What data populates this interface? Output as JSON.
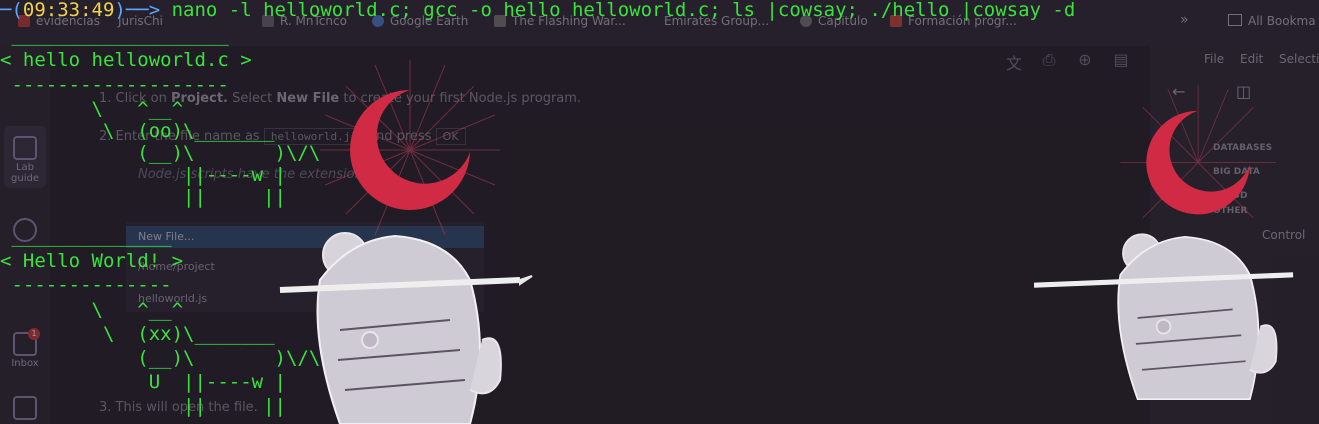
{
  "terminal": {
    "time": "09:33:49",
    "command": "nano -l helloworld.c; gcc -o hello helloworld.c; ls |cowsay; ./hello |cowsay -d",
    "cowsay_ls": {
      "bubble_top": " ___________________",
      "bubble_text": "< hello helloworld.c >",
      "bubble_bottom": " -------------------",
      "cow": "        \\   ^__^\n         \\  (oo)\\_______\n            (__)\\       )\\/\\\n                ||----w |\n                ||     ||"
    },
    "cowsay_hello": {
      "bubble_top": " ______________",
      "bubble_text": "< Hello World! >",
      "bubble_bottom": " --------------",
      "cow": "        \\   ^__^\n         \\  (xx)\\_______\n            (__)\\       )\\/\\\n             U  ||----w |\n                ||     ||"
    }
  },
  "background": {
    "tabs": [
      "evidencias",
      "JurisChi",
      "R. MnTcnco",
      "Google Earth",
      "The Flashing War...",
      "Emirates Group...",
      "Capitulo",
      "Formación progr..."
    ],
    "all_bookmarks": "All Bookma",
    "sidebar": {
      "lab_guide": "Lab guide",
      "inbox": "Inbox",
      "inbox_badge": "1"
    },
    "steps": {
      "step1_prefix": "1. Click on",
      "step1_bold1": "Project.",
      "step1_mid": "Select",
      "step1_bold2": "New File",
      "step1_suffix": "to create your first Node.js program.",
      "step2_prefix": "2. Enter the file name as",
      "step2_code": "helloworld.js",
      "step2_mid": "and press",
      "step2_ok": "OK",
      "note": "Node.js scripts have the extension .js",
      "step3": "3. This will open the file."
    },
    "dialog": {
      "new_file": "New File...",
      "path": "/home/project",
      "file": "helloworld.js"
    },
    "right_panel": {
      "menu_file": "File",
      "menu_edit": "Edit",
      "menu_select": "Selecti",
      "sec_databases": "DATABASES",
      "sec_bigdata": "BIG DATA",
      "sec_cloud": "CLOUD",
      "sec_other": "OTHER",
      "control": "Control"
    }
  },
  "colors": {
    "terminal_green": "#39e33c",
    "prompt_blue": "#5aa9ff",
    "time_yellow": "#f2d24a",
    "moon_red": "#d12a45"
  }
}
